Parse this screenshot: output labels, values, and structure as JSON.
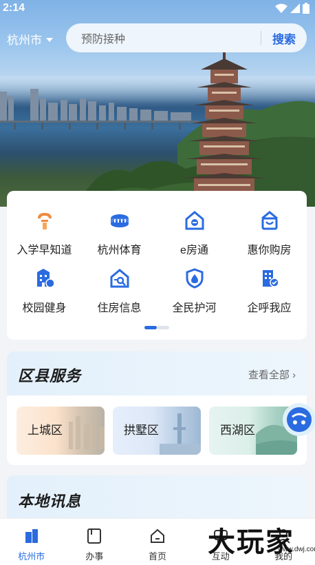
{
  "status_bar": {
    "time": "2:14"
  },
  "header": {
    "city": "杭州市",
    "search_placeholder": "预防接种",
    "search_button": "搜索"
  },
  "services": [
    {
      "label": "入学早知道",
      "icon": "school-enroll-icon",
      "color": "#f08a3c"
    },
    {
      "label": "杭州体育",
      "icon": "stadium-icon",
      "color": "#2a6be0"
    },
    {
      "label": "e房通",
      "icon": "e-house-icon",
      "color": "#2a6be0"
    },
    {
      "label": "惠你购房",
      "icon": "house-purchase-icon",
      "color": "#2a6be0"
    },
    {
      "label": "校园健身",
      "icon": "campus-fitness-icon",
      "color": "#2a6be0"
    },
    {
      "label": "住房信息",
      "icon": "housing-info-icon",
      "color": "#2a6be0"
    },
    {
      "label": "全民护河",
      "icon": "river-protect-icon",
      "color": "#2a6be0"
    },
    {
      "label": "企呼我应",
      "icon": "enterprise-response-icon",
      "color": "#2a6be0"
    }
  ],
  "district": {
    "title": "区县服务",
    "more": "查看全部 ›",
    "items": [
      "上城区",
      "拱墅区",
      "西湖区"
    ]
  },
  "news": {
    "title": "本地讯息"
  },
  "tabs": [
    {
      "label": "杭州市",
      "icon": "city-building-icon",
      "active": true
    },
    {
      "label": "办事",
      "icon": "document-icon",
      "active": false
    },
    {
      "label": "首页",
      "icon": "home-icon",
      "active": false
    },
    {
      "label": "互动",
      "icon": "interact-icon",
      "active": false
    },
    {
      "label": "我的",
      "icon": "profile-icon",
      "active": false
    }
  ],
  "watermark": {
    "big": "大玩家",
    "small": "www.dwj.com"
  },
  "colors": {
    "accent": "#2a6be0",
    "orange": "#f08a3c"
  }
}
